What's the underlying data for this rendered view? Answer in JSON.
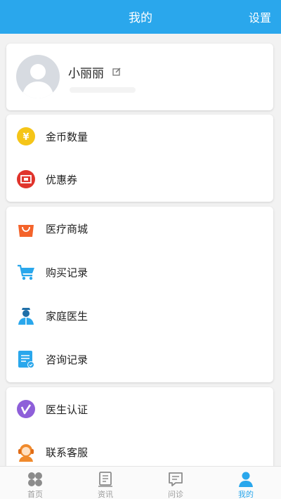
{
  "header": {
    "title": "我的",
    "settings_label": "设置"
  },
  "profile": {
    "username": "小丽丽"
  },
  "wallet": {
    "items": [
      {
        "label": "金币数量",
        "icon": "gold-coin-icon"
      },
      {
        "label": "优惠券",
        "icon": "coupon-icon"
      }
    ]
  },
  "services": {
    "items": [
      {
        "label": "医疗商城",
        "icon": "shopping-bag-icon"
      },
      {
        "label": "购买记录",
        "icon": "shopping-cart-icon"
      },
      {
        "label": "家庭医生",
        "icon": "doctor-icon"
      },
      {
        "label": "咨询记录",
        "icon": "consult-record-icon"
      }
    ]
  },
  "support": {
    "items": [
      {
        "label": "医生认证",
        "icon": "vimeo-v-icon"
      },
      {
        "label": "联系客服",
        "icon": "customer-service-icon"
      }
    ]
  },
  "tabbar": {
    "tabs": [
      {
        "label": "首页",
        "icon": "home-grid-icon",
        "active": false
      },
      {
        "label": "资讯",
        "icon": "news-icon",
        "active": false
      },
      {
        "label": "问诊",
        "icon": "consult-icon",
        "active": false
      },
      {
        "label": "我的",
        "icon": "profile-icon",
        "active": true
      }
    ]
  },
  "colors": {
    "accent": "#2aa7ec",
    "background": "#f2f2f2",
    "card": "#ffffff",
    "inactive_tab": "#9a9a9a"
  }
}
